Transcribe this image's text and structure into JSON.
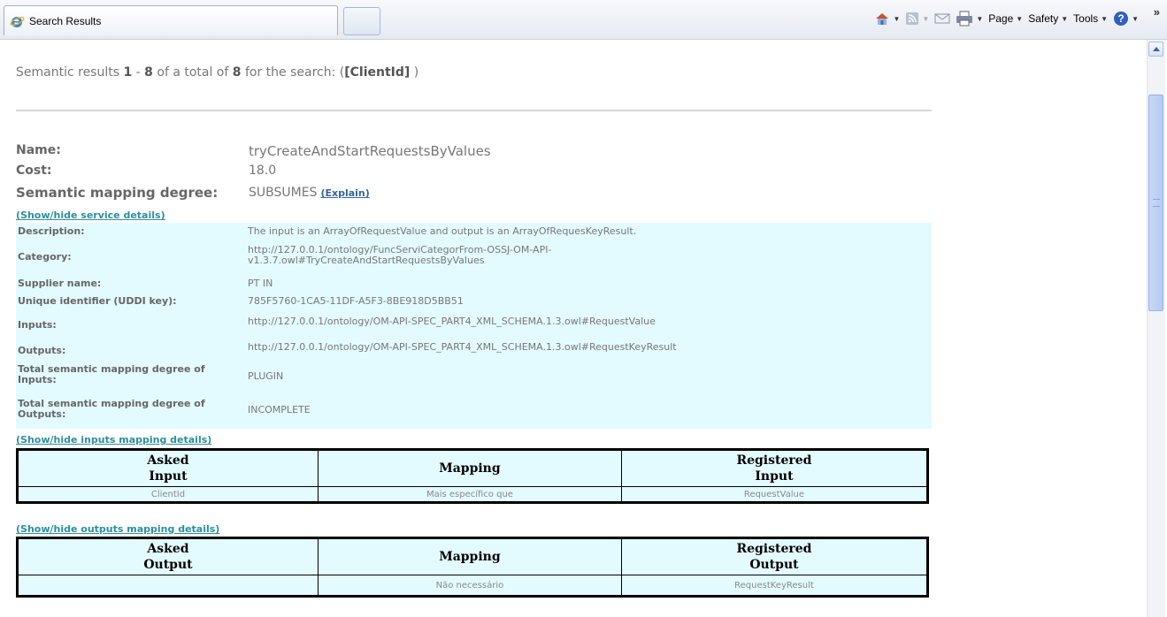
{
  "browser": {
    "tab_title": "Search Results",
    "commands": {
      "page": "Page",
      "safety": "Safety",
      "tools": "Tools"
    },
    "chevron": "»"
  },
  "summary": {
    "prefix": "Semantic results ",
    "range_start": "1",
    "range_sep": " - ",
    "range_end": "8",
    "middle": " of a total of ",
    "total": "8",
    "suffix_pre": " for the search: (",
    "query": "[ClientId]",
    "suffix_post": " )"
  },
  "result": {
    "name_label": "Name:",
    "name_value": "tryCreateAndStartRequestsByValues",
    "cost_label": "Cost:",
    "cost_value": "18.0",
    "degree_label": "Semantic mapping degree:",
    "degree_value": "SUBSUMES",
    "explain_link": "(Explain)",
    "service_toggle": "(Show/hide service details)"
  },
  "details": [
    {
      "label": "Description:",
      "value": "The input is an ArrayOfRequestValue and output is an ArrayOfRequesKeyResult."
    },
    {
      "label": "Category:",
      "value": "http://127.0.0.1/ontology/FuncServiCategorFrom-OSSJ-OM-API-v1.3.7.owl#TryCreateAndStartRequestsByValues"
    },
    {
      "label": "Supplier name:",
      "value": "PT IN"
    },
    {
      "label": "Unique identifier (UDDI key):",
      "value": "785F5760-1CA5-11DF-A5F3-8BE918D5BB51"
    },
    {
      "label": "Inputs:",
      "value": "http://127.0.0.1/ontology/OM-API-SPEC_PART4_XML_SCHEMA.1.3.owl#RequestValue"
    },
    {
      "label": "Outputs:",
      "value": "http://127.0.0.1/ontology/OM-API-SPEC_PART4_XML_SCHEMA.1.3.owl#RequestKeyResult"
    },
    {
      "label": "Total semantic mapping degree of Inputs:",
      "value": "PLUGIN"
    },
    {
      "label": "Total semantic mapping degree of Outputs:",
      "value": "INCOMPLETE"
    }
  ],
  "inputs_mapping": {
    "toggle": "(Show/hide inputs mapping details)",
    "headers": [
      "Asked\nInput",
      "Mapping",
      "Registered\nInput"
    ],
    "rows": [
      [
        "ClientId",
        "Mais específico que",
        "RequestValue"
      ]
    ]
  },
  "outputs_mapping": {
    "toggle": "(Show/hide outputs mapping details)",
    "headers": [
      "Asked\nOutput",
      "Mapping",
      "Registered\nOutput"
    ],
    "rows": [
      [
        "",
        "Não necessário",
        "RequestKeyResult"
      ]
    ]
  }
}
